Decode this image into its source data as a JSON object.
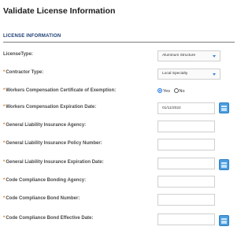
{
  "page": {
    "title": "Validate License Information"
  },
  "section": {
    "header": "LICENSE INFORMATION"
  },
  "fields": {
    "license_type": {
      "label": "LicenseType:",
      "value": "Aluminum Structure"
    },
    "contractor_type": {
      "required_mark": "*",
      "label": "Contractor Type:",
      "value": "Local Specialty"
    },
    "workers_comp_exemption": {
      "required_mark": "*",
      "label": "Workers Compensation Certificate of Exemption:",
      "yes_label": "Yes",
      "no_label": "No",
      "selected": "Yes"
    },
    "workers_comp_expiration": {
      "required_mark": "*",
      "label": "Workers Compensation Expiration Date:",
      "value": "01/11/2022"
    },
    "gl_agency": {
      "required_mark": "*",
      "label": "General Liability Insurance Agency:",
      "value": ""
    },
    "gl_policy_number": {
      "required_mark": "*",
      "label": "General Liability Insurance Policy Number:",
      "value": ""
    },
    "gl_expiration": {
      "required_mark": "*",
      "label": "General Liability Insurance Expiration Date:",
      "value": ""
    },
    "bonding_agency": {
      "required_mark": "*",
      "label": "Code Compliance Bonding Agency:",
      "value": ""
    },
    "bond_number": {
      "required_mark": "*",
      "label": "Code Compliance Bond Number:",
      "value": ""
    },
    "bond_effective": {
      "required_mark": "*",
      "label": "Code Compliance Bond Effective Date:",
      "value": ""
    }
  },
  "icons": {
    "calendar": "calendar-icon",
    "dropdown": "chevron-down-icon"
  },
  "colors": {
    "accent": "#1a73e8",
    "required": "#e07a1f",
    "section_header": "#1c3d73",
    "calendar": "#4a9ee0"
  }
}
